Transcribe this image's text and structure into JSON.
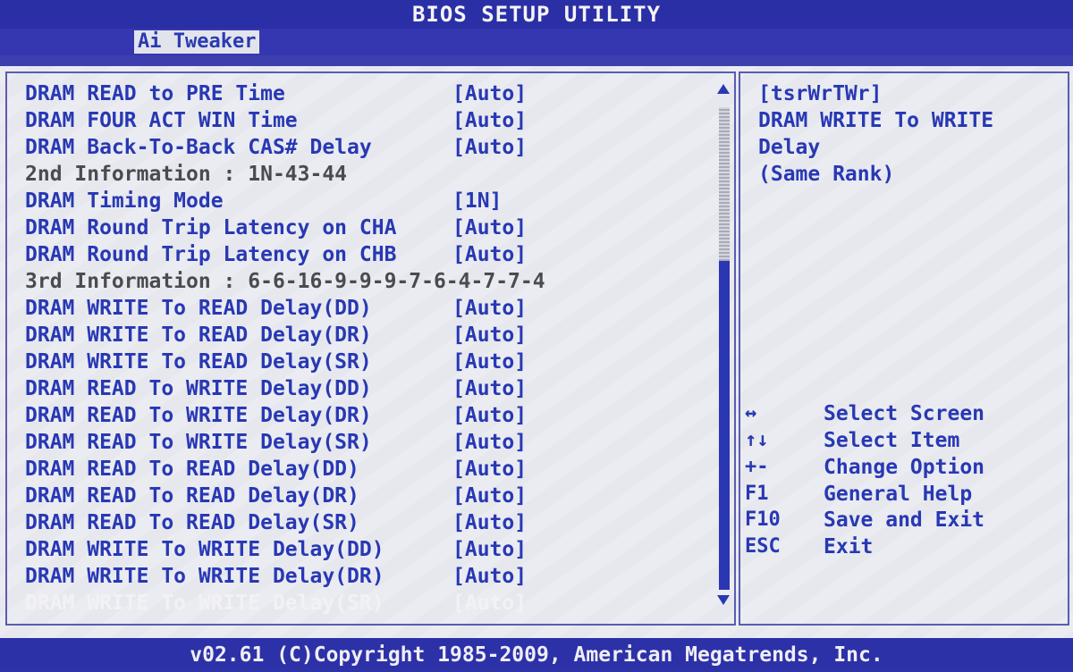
{
  "title": "BIOS SETUP UTILITY",
  "menu": {
    "active_tab": "Ai Tweaker"
  },
  "settings": [
    {
      "label": "DRAM READ to PRE Time",
      "value": "[Auto]",
      "kind": "item"
    },
    {
      "label": "DRAM FOUR ACT WIN Time",
      "value": "[Auto]",
      "kind": "item"
    },
    {
      "label": "DRAM Back-To-Back CAS# Delay",
      "value": "[Auto]",
      "kind": "item"
    },
    {
      "label": "2nd Information : 1N-43-44",
      "value": "",
      "kind": "info"
    },
    {
      "label": "DRAM Timing Mode",
      "value": "[1N]",
      "kind": "item"
    },
    {
      "label": "DRAM Round Trip Latency on CHA",
      "value": "[Auto]",
      "kind": "item"
    },
    {
      "label": "DRAM Round Trip Latency on CHB",
      "value": "[Auto]",
      "kind": "item"
    },
    {
      "label": "3rd Information : 6-6-16-9-9-9-7-6-4-7-7-4",
      "value": "",
      "kind": "info"
    },
    {
      "label": "DRAM WRITE To READ Delay(DD)",
      "value": "[Auto]",
      "kind": "item"
    },
    {
      "label": "DRAM WRITE To READ Delay(DR)",
      "value": "[Auto]",
      "kind": "item"
    },
    {
      "label": "DRAM WRITE To READ Delay(SR)",
      "value": "[Auto]",
      "kind": "item"
    },
    {
      "label": "DRAM READ To WRITE Delay(DD)",
      "value": "[Auto]",
      "kind": "item"
    },
    {
      "label": "DRAM READ To WRITE Delay(DR)",
      "value": "[Auto]",
      "kind": "item"
    },
    {
      "label": "DRAM READ To WRITE Delay(SR)",
      "value": "[Auto]",
      "kind": "item"
    },
    {
      "label": "DRAM READ To READ Delay(DD)",
      "value": "[Auto]",
      "kind": "item"
    },
    {
      "label": "DRAM READ To READ Delay(DR)",
      "value": "[Auto]",
      "kind": "item"
    },
    {
      "label": "DRAM READ To READ Delay(SR)",
      "value": "[Auto]",
      "kind": "item"
    },
    {
      "label": "DRAM WRITE To WRITE Delay(DD)",
      "value": "[Auto]",
      "kind": "item"
    },
    {
      "label": "DRAM WRITE To WRITE Delay(DR)",
      "value": "[Auto]",
      "kind": "item"
    },
    {
      "label": "DRAM WRITE To WRITE Delay(SR)",
      "value": "[Auto]",
      "kind": "selected"
    }
  ],
  "help": {
    "lines": [
      "[tsrWrTWr]",
      "DRAM WRITE To WRITE",
      "Delay",
      "(Same Rank)"
    ]
  },
  "keys": [
    {
      "key": "↔",
      "desc": "Select Screen"
    },
    {
      "key": "↑↓",
      "desc": "Select Item"
    },
    {
      "key": "+-",
      "desc": "Change Option"
    },
    {
      "key": "F1",
      "desc": "General Help"
    },
    {
      "key": "F10",
      "desc": "Save and Exit"
    },
    {
      "key": "ESC",
      "desc": "Exit"
    }
  ],
  "footer": "v02.61 (C)Copyright 1985-2009, American Megatrends, Inc.",
  "colors": {
    "header_bg": "#2b2fa6",
    "panel_bg": "#e6e8ee",
    "item_text": "#2838b4",
    "info_text": "#4a4a54",
    "selected_text": "#f2f2f6"
  }
}
